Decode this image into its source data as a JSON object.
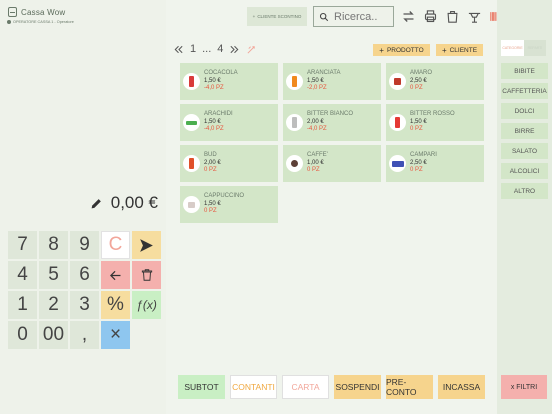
{
  "app": {
    "name": "Cassa Wow",
    "operator": "OPERATORE CASSA 1 - Operatore"
  },
  "amount": {
    "value": "0,00 €"
  },
  "keypad": {
    "keys": [
      "7",
      "8",
      "9",
      "C",
      "4",
      "5",
      "6",
      "1",
      "2",
      "3",
      "%",
      "ƒ(x)",
      "0",
      "00",
      ",",
      "×"
    ]
  },
  "topbar": {
    "cliente_sconto": "CLIENTE SCONTINO",
    "search_placeholder": "Ricerca.."
  },
  "pager": {
    "current": "1",
    "sep": "...",
    "total": "4"
  },
  "actions": {
    "add_product": "PRODOTTO",
    "add_client": "CLIENTE"
  },
  "products": [
    {
      "name": "COCACOLA",
      "price": "1,50 €",
      "qty": "-4,0 PZ",
      "color": "#d93b3b"
    },
    {
      "name": "ARANCIATA",
      "price": "1,50 €",
      "qty": "-2,0 PZ",
      "color": "#f08a1e"
    },
    {
      "name": "AMARO",
      "price": "2,50 €",
      "qty": "0 PZ",
      "color": "#c0392b"
    },
    {
      "name": "ARACHIDI",
      "price": "1,50 €",
      "qty": "-4,0 PZ",
      "color": "#4caf50"
    },
    {
      "name": "BITTER BIANCO",
      "price": "2,00 €",
      "qty": "-4,0 PZ",
      "color": "#bdbdbd"
    },
    {
      "name": "BITTER ROSSO",
      "price": "1,50 €",
      "qty": "0 PZ",
      "color": "#e53935"
    },
    {
      "name": "BUD",
      "price": "2,00 €",
      "qty": "0 PZ",
      "color": "#e0502a"
    },
    {
      "name": "CAFFE'",
      "price": "1,00 €",
      "qty": "0 PZ",
      "color": "#5d4037"
    },
    {
      "name": "CAMPARI",
      "price": "2,50 €",
      "qty": "0 PZ",
      "color": "#3f51b5"
    },
    {
      "name": "CAPPUCCINO",
      "price": "1,50 €",
      "qty": "0 PZ",
      "color": "#d7ccc8"
    }
  ],
  "categories": {
    "tab_on": "CATEGORIE",
    "tab_off": "REPARTI",
    "items": [
      "BIBITE",
      "CAFFETTERIA",
      "DOLCI",
      "BIRRE",
      "SALATO",
      "ALCOLICI",
      "ALTRO"
    ],
    "filtri": "x FILTRI"
  },
  "bottom": {
    "subtot": "SUBTOT",
    "contanti": "CONTANTI",
    "carta": "CARTA",
    "sospendi": "SOSPENDI",
    "preconto": "PRE-CONTO",
    "incassa": "INCASSA"
  },
  "colors": {
    "accent": "#e8553e",
    "green": "#c9efc4",
    "yellow": "#f6d48d",
    "pink": "#f4b0ad"
  }
}
